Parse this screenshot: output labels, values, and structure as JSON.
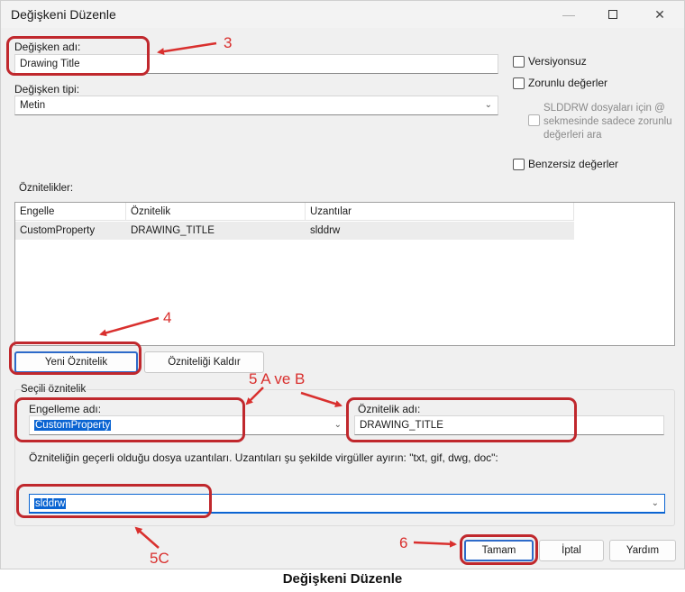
{
  "window": {
    "title": "Değişkeni Düzenle"
  },
  "form": {
    "variable_name_label": "Değişken adı:",
    "variable_name_value": "Drawing Title",
    "variable_type_label": "Değişken tipi:",
    "variable_type_value": "Metin",
    "attributes_label": "Öznitelikler:"
  },
  "options": {
    "unversioned": "Versiyonsuz",
    "required_values": "Zorunlu değerler",
    "slddrw_note": [
      "SLDDRW dosyaları için @",
      "sekmesinde sadece zorunlu",
      "değerleri ara"
    ],
    "unique_values": "Benzersiz değerler"
  },
  "attributes_table": {
    "columns": [
      "Engelle",
      "Öznitelik",
      "Uzantılar"
    ],
    "rows": [
      [
        "CustomProperty",
        "DRAWING_TITLE",
        "slddrw"
      ]
    ]
  },
  "buttons": {
    "new_attribute": "Yeni Öznitelik",
    "remove_attribute": "Özniteliği Kaldır",
    "ok": "Tamam",
    "cancel": "İptal",
    "help": "Yardım"
  },
  "selected_attribute": {
    "group_label": "Seçili öznitelik",
    "block_name_label": "Engelleme adı:",
    "block_name_value": "CustomProperty",
    "attribute_name_label": "Öznitelik adı:",
    "attribute_name_value": "DRAWING_TITLE",
    "extensions_help": "Özniteliğin geçerli olduğu dosya uzantıları. Uzantıları şu şekilde virgüller ayırın: \"txt, gif, dwg, doc\":",
    "extensions_value": "slddrw"
  },
  "annotations": {
    "step3": "3",
    "step4": "4",
    "step5ab": "5 A ve B",
    "step5c": "5C",
    "step6": "6",
    "color": "#c0282d"
  },
  "caption": "Değişkeni Düzenle"
}
